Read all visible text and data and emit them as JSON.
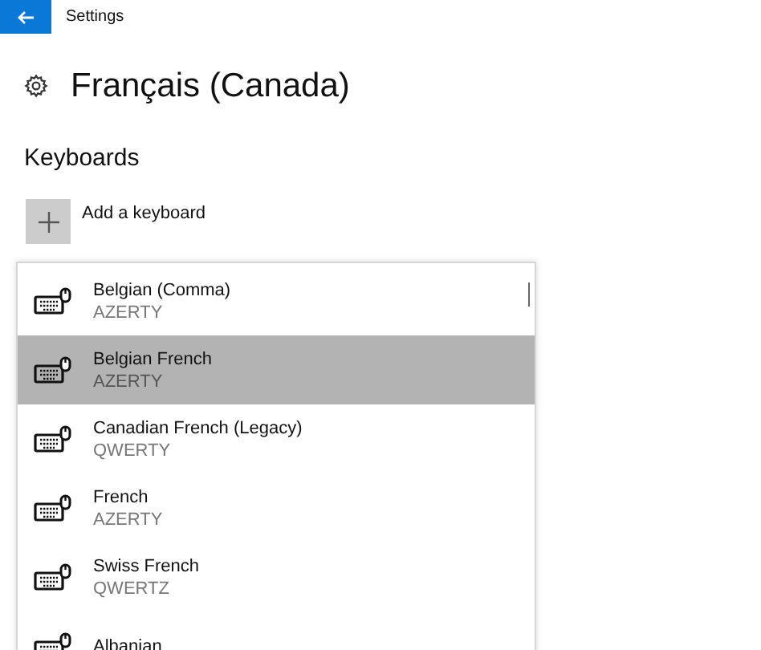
{
  "window": {
    "title": "Settings"
  },
  "page": {
    "title": "Français (Canada)"
  },
  "section": {
    "title": "Keyboards"
  },
  "add_button": {
    "label": "Add a keyboard"
  },
  "keyboard_list": [
    {
      "name": "Belgian (Comma)",
      "layout": "AZERTY",
      "selected": false
    },
    {
      "name": "Belgian French",
      "layout": "AZERTY",
      "selected": true
    },
    {
      "name": "Canadian French (Legacy)",
      "layout": "QWERTY",
      "selected": false
    },
    {
      "name": "French",
      "layout": "AZERTY",
      "selected": false
    },
    {
      "name": "Swiss French",
      "layout": "QWERTZ",
      "selected": false
    },
    {
      "name": "Albanian",
      "selected": false
    }
  ]
}
